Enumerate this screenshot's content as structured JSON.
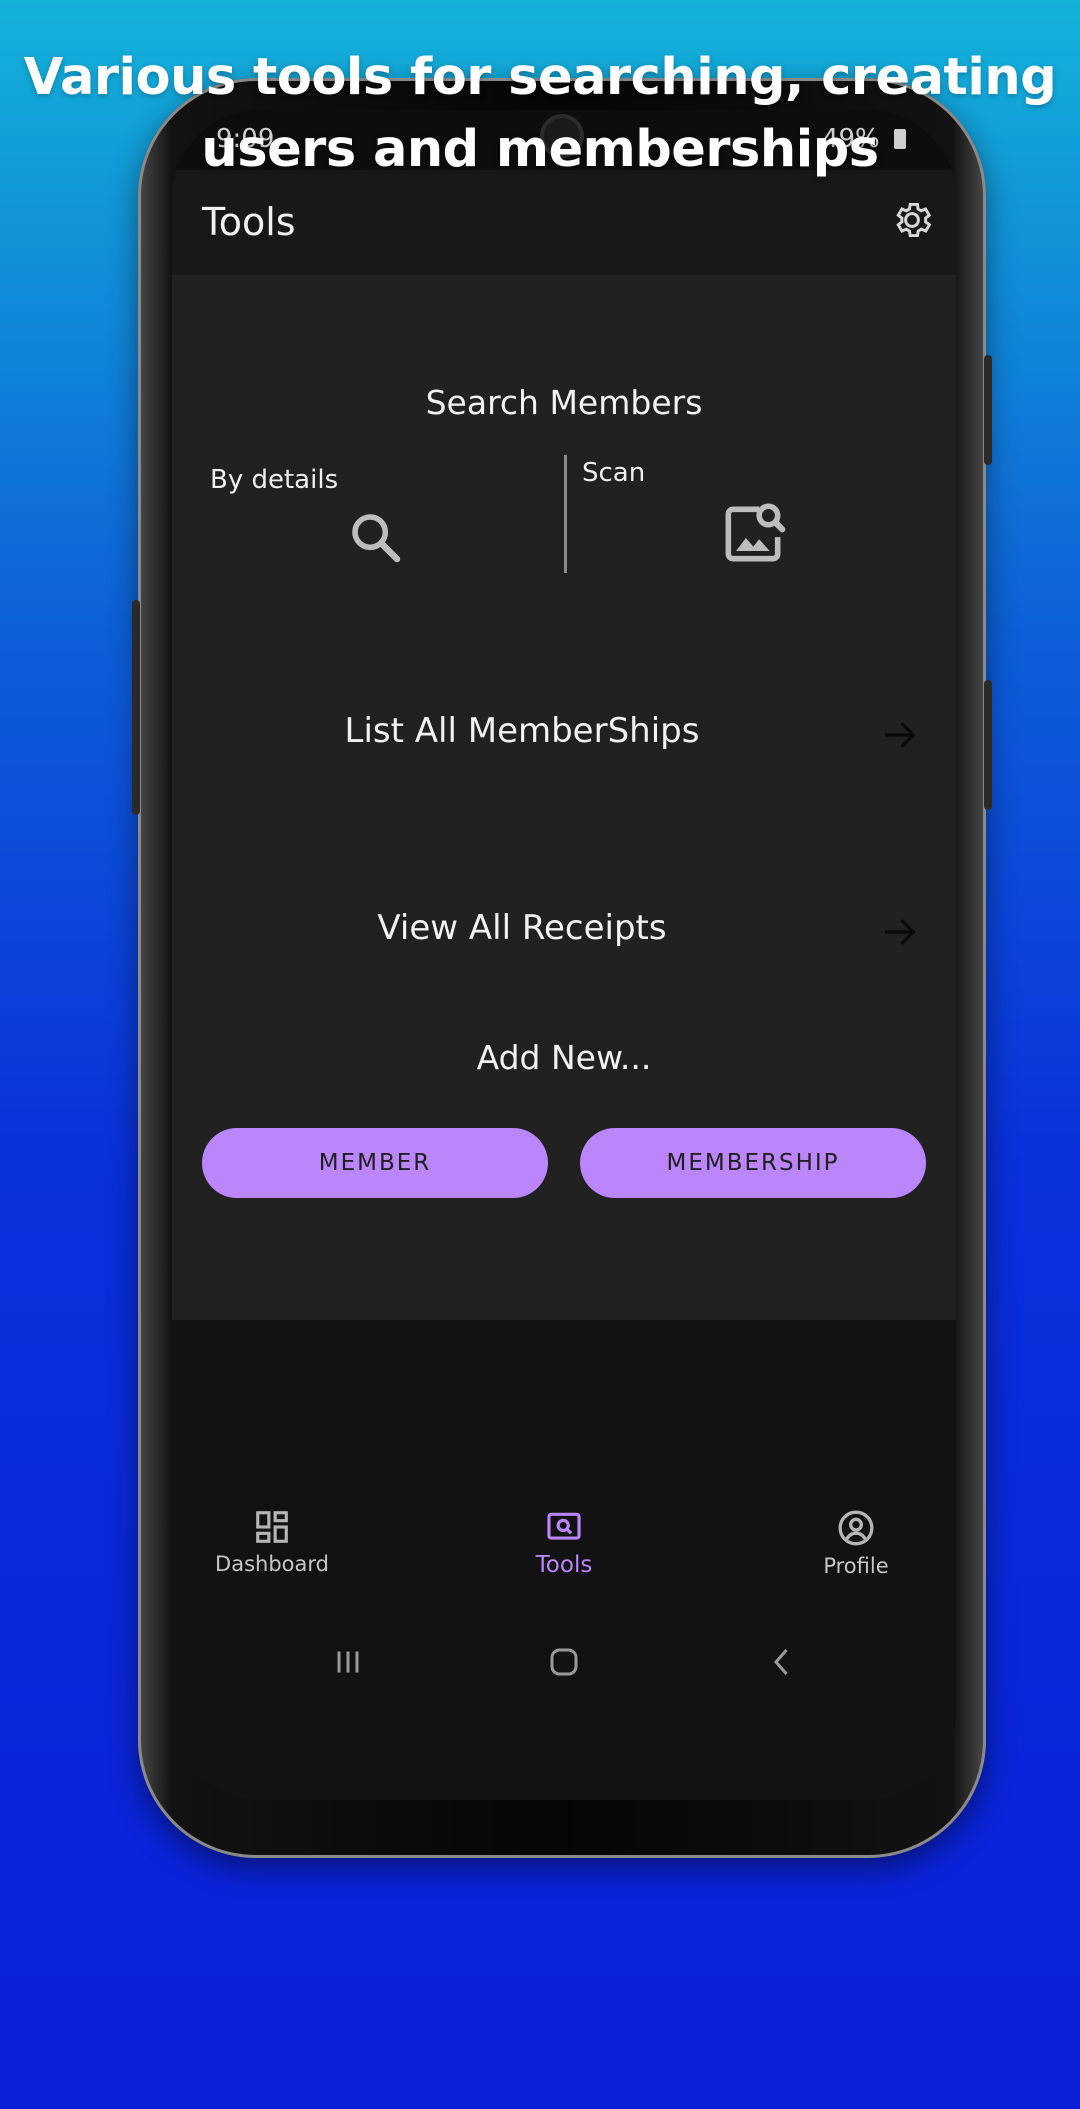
{
  "headline": {
    "line1": "Various tools for searching, creating",
    "line2": "users and memberships"
  },
  "status_bar": {
    "time": "9:09",
    "battery": "49%"
  },
  "app_bar": {
    "title": "Tools",
    "settings_icon": "gear-icon"
  },
  "search_members": {
    "title": "Search Members",
    "by_details_label": "By details",
    "scan_label": "Scan"
  },
  "links": [
    {
      "label": "List All MemberShips"
    },
    {
      "label": "View All Receipts"
    }
  ],
  "add_new": {
    "title": "Add New...",
    "member_button": "MEMBER",
    "membership_button": "MEMBERSHIP"
  },
  "bottom_nav": {
    "items": [
      {
        "label": "Dashboard",
        "icon": "dashboard-icon",
        "active": false
      },
      {
        "label": "Tools",
        "icon": "tools-icon",
        "active": true
      },
      {
        "label": "Profile",
        "icon": "profile-icon",
        "active": false
      }
    ]
  },
  "colors": {
    "accent": "#bb86fc",
    "surface": "#212121",
    "background": "#121212"
  }
}
